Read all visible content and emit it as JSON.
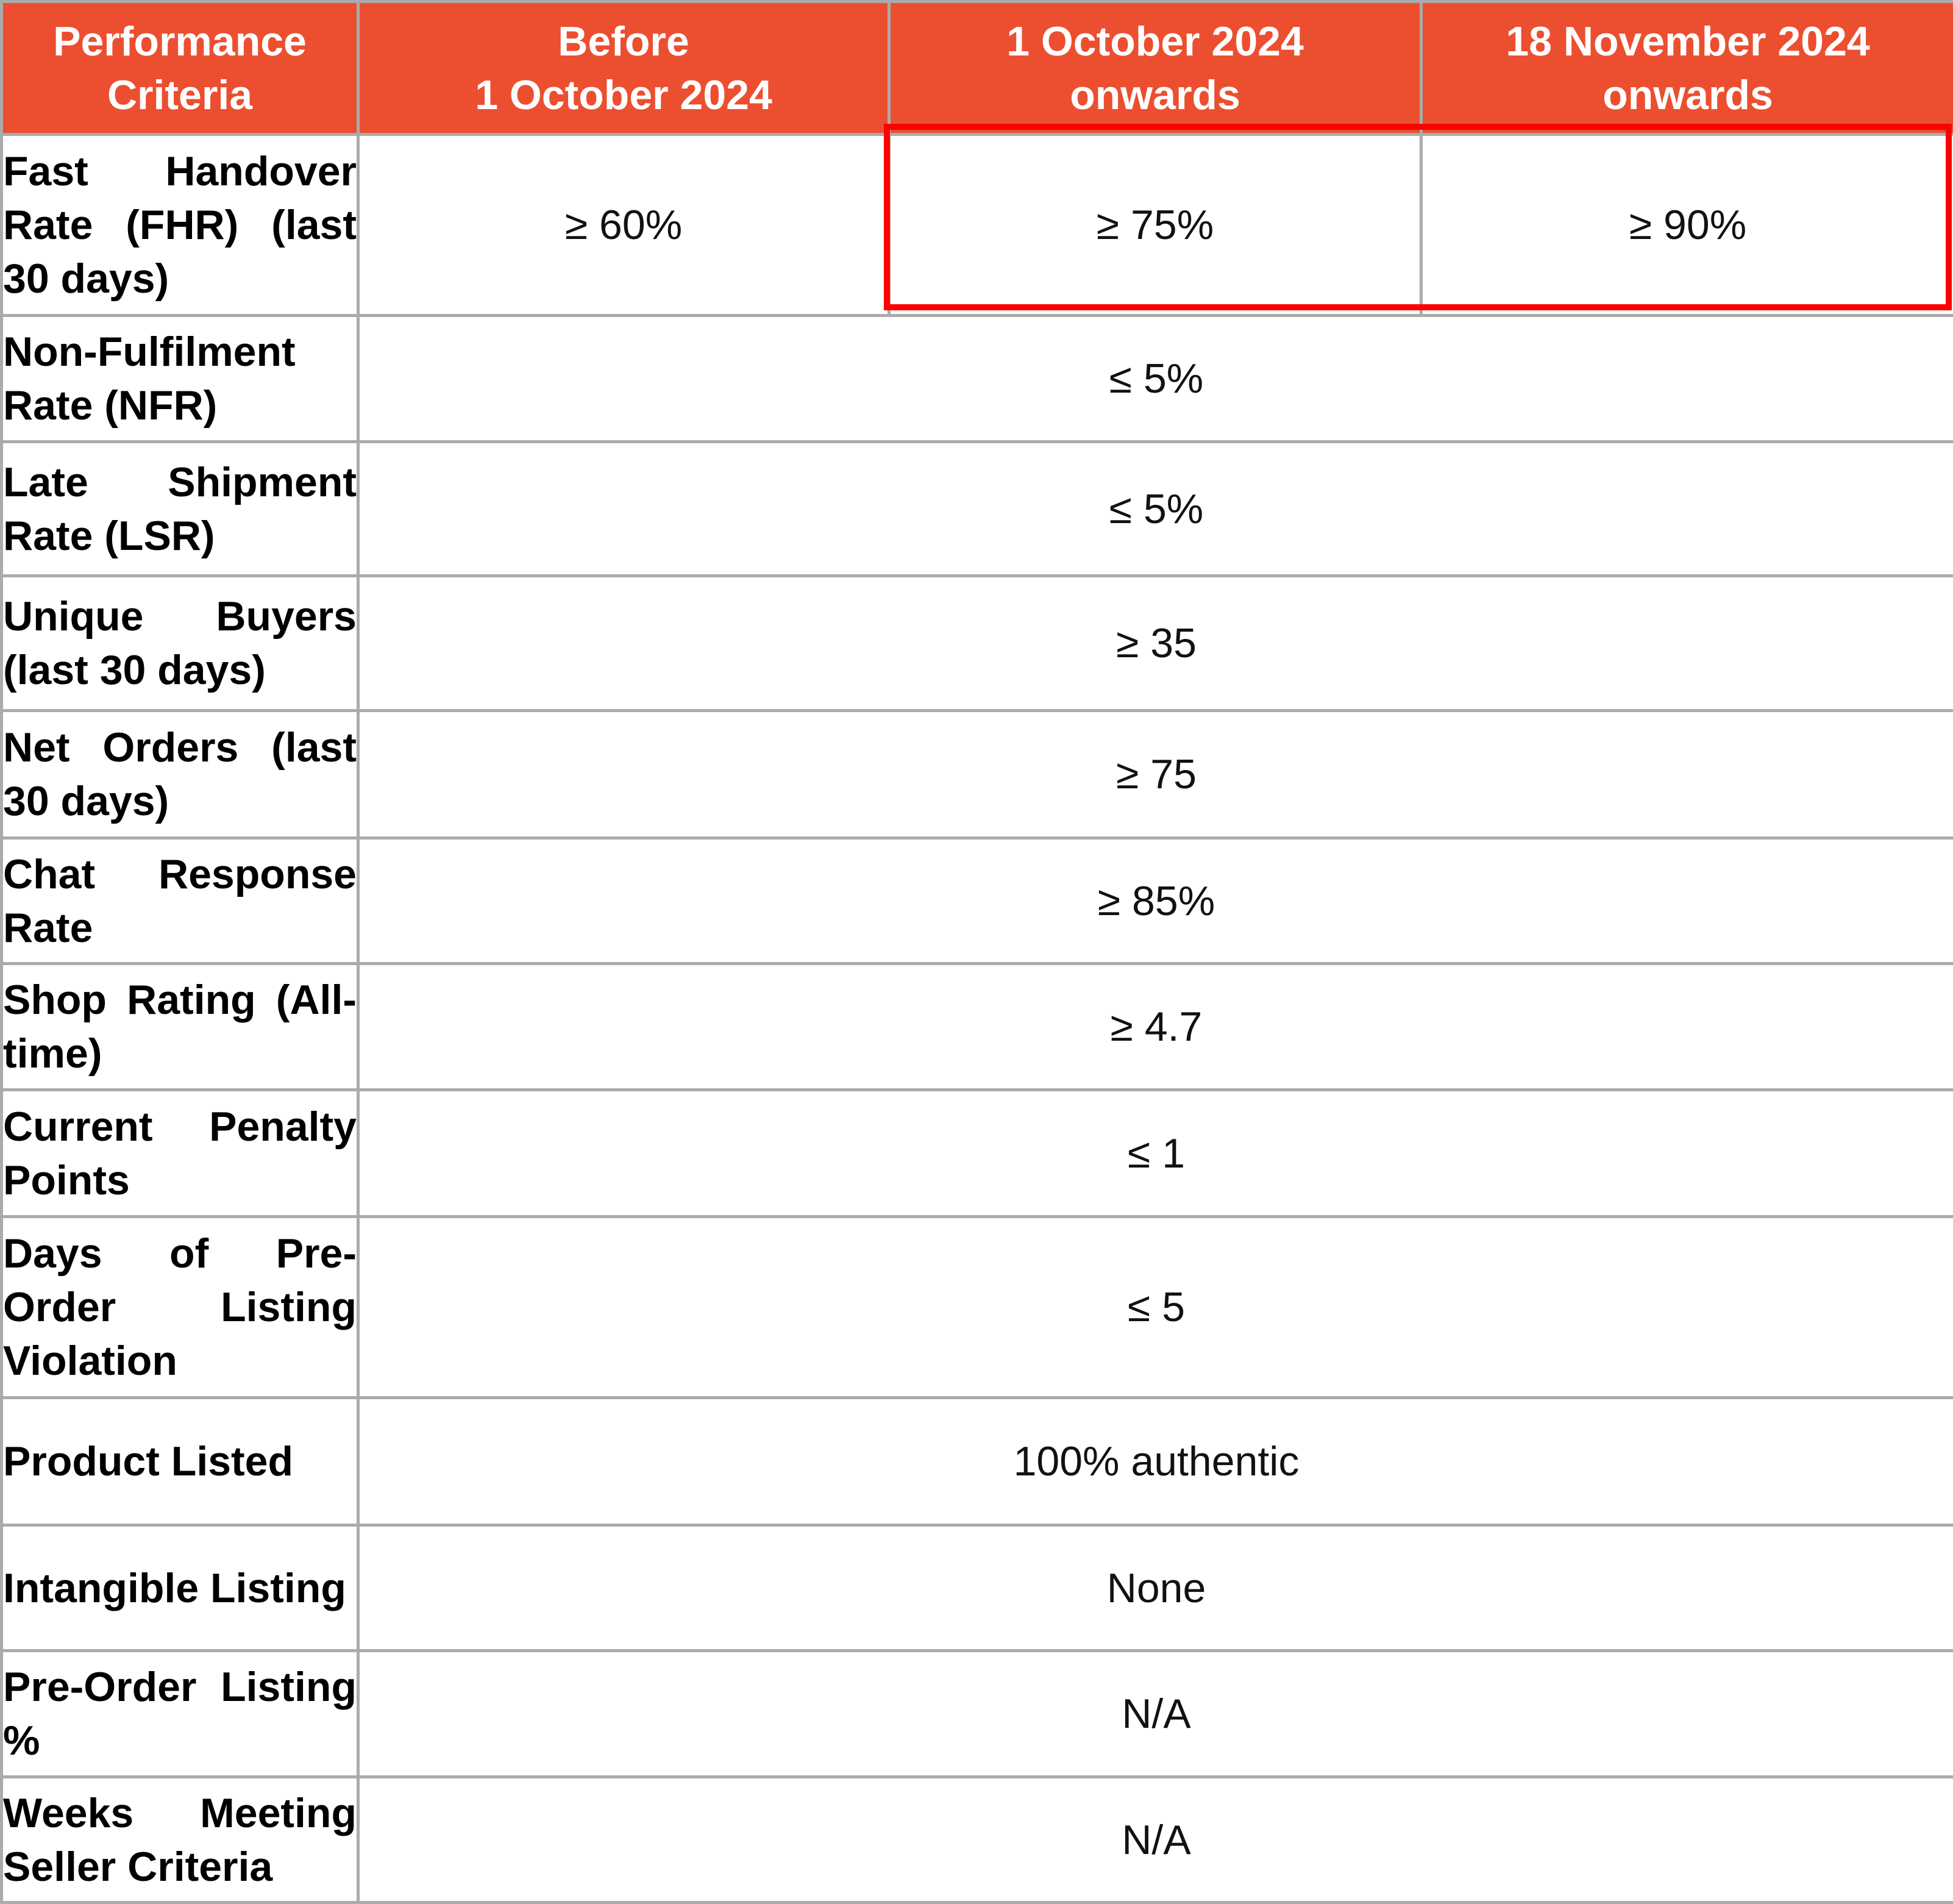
{
  "table": {
    "headers": [
      "Performance\nCriteria",
      "Before\n1 October 2024",
      "1 October 2024\nonwards",
      "18 November 2024\nonwards"
    ],
    "rows": [
      {
        "criterion": "Fast Handover Rate (FHR) (last 30 days)",
        "before_1_oct_2024": "≥ 60%",
        "from_1_oct_2024": "≥ 75%",
        "from_18_nov_2024": "≥ 90%"
      },
      {
        "criterion": "Non-Fulfilment Rate (NFR)",
        "value_all_periods": "≤ 5%"
      },
      {
        "criterion": "Late Shipment Rate (LSR)",
        "value_all_periods": "≤ 5%"
      },
      {
        "criterion": "Unique Buyers (last 30 days)",
        "value_all_periods": "≥ 35"
      },
      {
        "criterion": "Net Orders (last 30 days)",
        "value_all_periods": "≥ 75"
      },
      {
        "criterion": "Chat Response Rate",
        "value_all_periods": "≥ 85%"
      },
      {
        "criterion": "Shop Rating (All-time)",
        "value_all_periods": "≥ 4.7"
      },
      {
        "criterion": "Current Penalty Points",
        "value_all_periods": "≤ 1"
      },
      {
        "criterion": "Days of Pre-Order Listing Violation",
        "value_all_periods": "≤ 5"
      },
      {
        "criterion": "Product Listed",
        "value_all_periods": "100% authentic"
      },
      {
        "criterion": "Intangible Listing",
        "value_all_periods": "None"
      },
      {
        "criterion": "Pre-Order Listing %",
        "value_all_periods": "N/A"
      },
      {
        "criterion": "Weeks Meeting Seller Criteria",
        "value_all_periods": "N/A"
      }
    ],
    "highlight": {
      "description": "FHR thresholds from 1 October 2024 and 18 November 2024",
      "color": "#ff0000"
    }
  },
  "colors": {
    "header_bg": "#ec4f30",
    "header_text": "#ffffff",
    "grid": "#ababab",
    "highlight": "#ff0000"
  }
}
